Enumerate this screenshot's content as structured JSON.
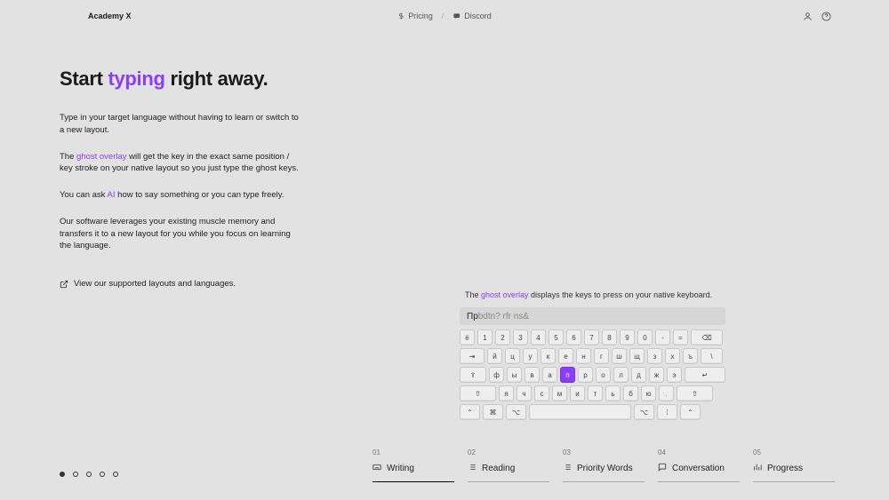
{
  "header": {
    "brand": "Academy X",
    "pricing": "Pricing",
    "discord": "Discord",
    "sep": "/"
  },
  "hero": {
    "h_pre": "Start ",
    "h_accent": "typing",
    "h_post": " right away.",
    "p1": "Type in your target language without having to learn or switch to a new layout.",
    "p2_pre": "The ",
    "p2_ghost": "ghost overlay",
    "p2_post": " will get the key in the exact same position / key stroke on your native layout so you just type the ghost keys.",
    "p3_pre": "You can ask ",
    "p3_accent": "AI",
    "p3_post": " how to say something or you can type freely.",
    "p4": "Our software leverages your existing muscle memory and transfers it to a new layout for you while you focus on learning the language.",
    "supported": "View our supported layouts and languages."
  },
  "kbd": {
    "caption_pre": "The ",
    "caption_ghost": "ghost overlay",
    "caption_post": " displays the keys to press on your native keyboard.",
    "input_typed": "Пр",
    "input_ghost": "bdtn? rfr ns&",
    "row1": [
      "ë",
      "1",
      "2",
      "3",
      "4",
      "5",
      "6",
      "7",
      "8",
      "9",
      "0",
      "-",
      "=",
      "⌫"
    ],
    "row2": [
      "⇥",
      "й",
      "ц",
      "у",
      "к",
      "е",
      "н",
      "г",
      "ш",
      "щ",
      "з",
      "х",
      "ъ",
      "\\"
    ],
    "row3": [
      "⇪",
      "ф",
      "ы",
      "в",
      "а",
      "п",
      "р",
      "о",
      "л",
      "д",
      "ж",
      "э",
      "↵"
    ],
    "row4": [
      "⇧",
      "я",
      "ч",
      "с",
      "м",
      "и",
      "т",
      "ь",
      "б",
      "ю",
      ".",
      "⇧"
    ],
    "row5": [
      "⌃",
      "⌘",
      "⌥",
      "",
      "⌥",
      "⁞",
      "⌃"
    ],
    "highlight_row": 3,
    "highlight_col": 6
  },
  "tabs": [
    {
      "num": "01",
      "label": "Writing",
      "icon": "keyboard",
      "active": true
    },
    {
      "num": "02",
      "label": "Reading",
      "icon": "list",
      "active": false
    },
    {
      "num": "03",
      "label": "Priority Words",
      "icon": "list",
      "active": false
    },
    {
      "num": "04",
      "label": "Conversation",
      "icon": "chat",
      "active": false
    },
    {
      "num": "05",
      "label": "Progress",
      "icon": "bars",
      "active": false
    }
  ],
  "dots": [
    true,
    false,
    false,
    false,
    false
  ]
}
